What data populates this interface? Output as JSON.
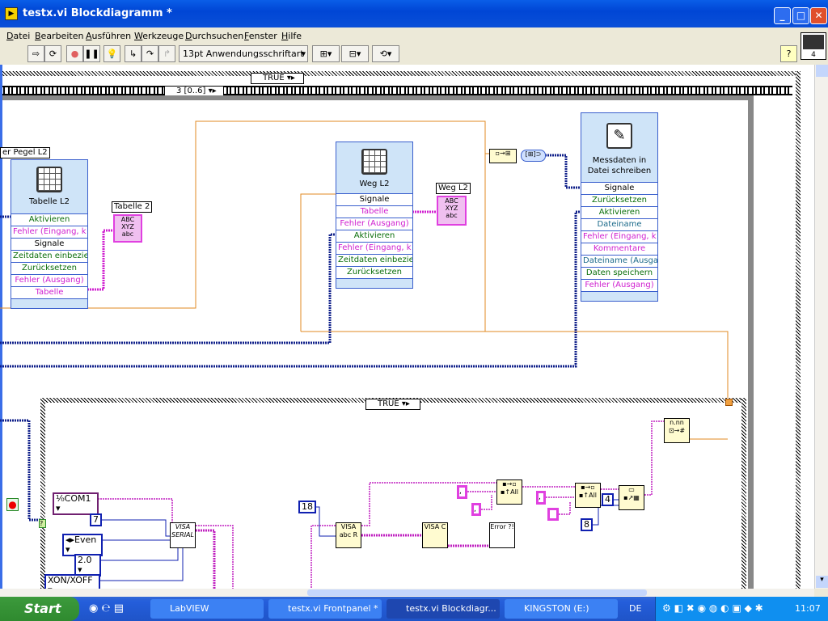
{
  "window": {
    "title": "testx.vi Blockdiagramm *",
    "icon": "labview-vi-icon",
    "controls": [
      "minimize",
      "maximize",
      "close"
    ]
  },
  "menu": [
    "Datei",
    "Bearbeiten",
    "Ausführen",
    "Werkzeuge",
    "Durchsuchen",
    "Fenster",
    "Hilfe"
  ],
  "toolbar": {
    "buttons": [
      "run-arrow",
      "run-continuously",
      "abort",
      "pause",
      "highlight-execution",
      "step-into",
      "step-over",
      "step-out"
    ],
    "font_select": "13pt Anwendungsschriftart",
    "help": "?",
    "connector_number": "4"
  },
  "diagram": {
    "outer_case_selector": "TRUE",
    "sequence_selector": "3 [0..6]",
    "label_pegel": "er Pegel L2",
    "tabelle_l2": {
      "title": "Tabelle L2",
      "rows": [
        "Aktivieren",
        "Fehler (Eingang, k",
        "Signale",
        "Zeitdaten einbezie",
        "Zurücksetzen",
        "Fehler (Ausgang)",
        "Tabelle"
      ]
    },
    "tabelle2_label": "Tabelle 2",
    "weg_l2": {
      "title": "Weg L2",
      "rows": [
        "Signale",
        "Tabelle",
        "Fehler (Ausgang)",
        "Aktivieren",
        "Fehler (Eingang, k",
        "Zeitdaten einbezie",
        "Zurücksetzen"
      ]
    },
    "weg_l2_label": "Weg L2",
    "messdaten": {
      "title": "Messdaten in Datei schreiben",
      "rows": [
        "Signale",
        "Zurücksetzen",
        "Aktivieren",
        "Dateiname",
        "Fehler (Eingang, k",
        "Kommentare",
        "Dateiname (Ausga",
        "Daten speichern",
        "Fehler (Ausgang)"
      ]
    },
    "inner_case_selector": "TRUE",
    "constants": {
      "com": "COM1",
      "databits": "7",
      "parity": "Even",
      "stopbits": "2.0",
      "flow": "XON/XOFF",
      "bytes": "18",
      "c4": "4",
      "c8": "8",
      "sep1": ",",
      "sep2": ",",
      "sep3": ",",
      "sep4": ""
    },
    "nodes": {
      "visa_serial": "VISA SERIAL",
      "visa_read": "VISA abc R",
      "visa_close": "VISA C",
      "error": "Error ?!",
      "number": "n.nn"
    },
    "case_terminal": "?"
  },
  "taskbar": {
    "start": "Start",
    "items": [
      "LabVIEW",
      "testx.vi Frontpanel *",
      "testx.vi Blockdiagr...",
      "KINGSTON (E:)"
    ],
    "lang": "DE",
    "clock": "11:07"
  }
}
